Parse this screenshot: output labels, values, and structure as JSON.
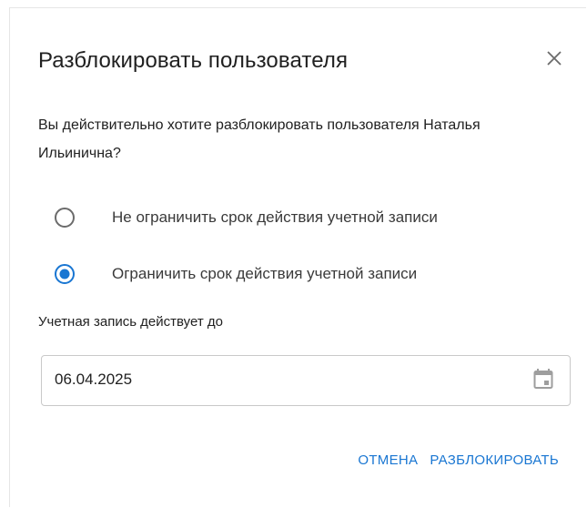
{
  "dialog": {
    "title": "Разблокировать пользователя",
    "message": "Вы действительно хотите разблокировать пользователя Наталья Ильинична?",
    "options": [
      {
        "label": "Не ограничить срок действия учетной записи",
        "selected": false
      },
      {
        "label": "Ограничить срок действия учетной записи",
        "selected": true
      }
    ],
    "date_label": "Учетная запись действует до",
    "date_value": "06.04.2025",
    "cancel_label": "ОТМЕНА",
    "confirm_label": "РАЗБЛОКИРОВАТЬ",
    "close_icon": "close-icon",
    "calendar_icon": "calendar-icon"
  },
  "colors": {
    "accent": "#1976d2",
    "text": "#212121",
    "radio_unselected": "#6b6b6b",
    "border": "#c9c9c9"
  }
}
